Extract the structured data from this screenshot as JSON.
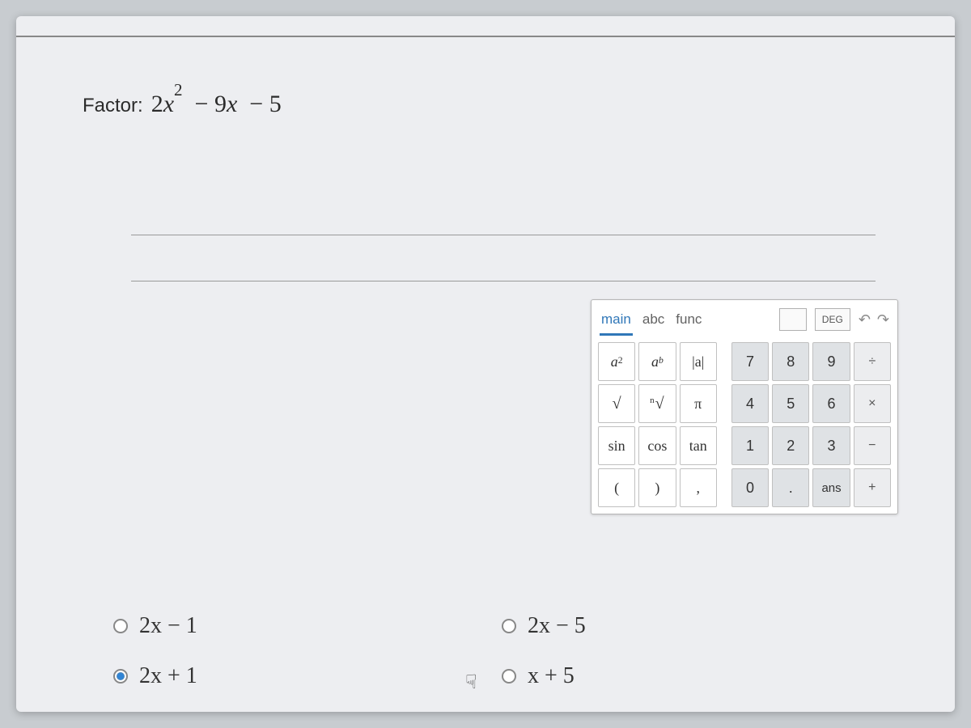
{
  "question": {
    "label": "Factor:",
    "expression_coef": "2",
    "expression_html_parts": {
      "a": "2",
      "b": "9",
      "c": "5"
    }
  },
  "keypad": {
    "tabs": {
      "main": "main",
      "abc": "abc",
      "func": "func"
    },
    "deg": "DEG",
    "undo": "↶",
    "redo": "↷",
    "keys": {
      "a2": "a",
      "a2_sup": "2",
      "ab": "a",
      "ab_sup": "b",
      "abs": "|a|",
      "sqrt": "√",
      "nroot_n": "n",
      "nroot": "√",
      "pi": "π",
      "sin": "sin",
      "cos": "cos",
      "tan": "tan",
      "lp": "(",
      "rp": ")",
      "comma": ",",
      "n7": "7",
      "n8": "8",
      "n9": "9",
      "div": "÷",
      "n4": "4",
      "n5": "5",
      "n6": "6",
      "mul": "×",
      "n1": "1",
      "n2": "2",
      "n3": "3",
      "sub": "−",
      "n0": "0",
      "dot": ".",
      "ans": "ans",
      "add": "+"
    }
  },
  "options": {
    "o1": {
      "a": "2",
      "b": "1",
      "op": "−"
    },
    "o2": {
      "a": "2",
      "b": "5",
      "op": "−"
    },
    "o3": {
      "a": "2",
      "b": "1",
      "op": "+"
    },
    "o4": {
      "a": "",
      "b": "5",
      "op": "+",
      "coef": ""
    }
  },
  "options_text": {
    "o1": "2x − 1",
    "o2": "2x − 5",
    "o3": "2x + 1",
    "o4": "x + 5"
  },
  "selected": "o3"
}
